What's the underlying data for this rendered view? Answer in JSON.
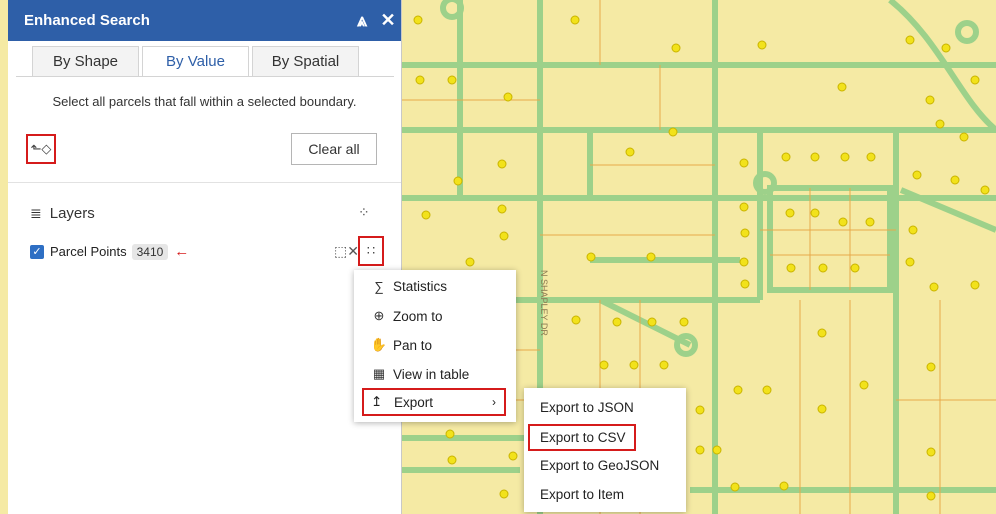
{
  "panel": {
    "title": "Enhanced Search",
    "collapse_icon": "double-chevron-up-icon",
    "close_icon": "close-icon",
    "tabs": [
      {
        "label": "By Shape",
        "active": false
      },
      {
        "label": "By Value",
        "active": true
      },
      {
        "label": "By Spatial",
        "active": false
      }
    ],
    "description": "Select all parcels that fall within a selected boundary.",
    "select_tool_icon": "select-by-polygon-icon",
    "clear_label": "Clear all",
    "layers_label": "Layers",
    "layers_settings_icon": "layer-options-icon",
    "layer": {
      "name": "Parcel Points",
      "count": "3410",
      "checked": true,
      "clear_icon": "clear-selection-icon",
      "actions_icon": "actions-grid-icon"
    }
  },
  "context_menu": {
    "items": [
      {
        "icon": "sigma-icon",
        "label": "Statistics"
      },
      {
        "icon": "zoom-to-icon",
        "label": "Zoom to"
      },
      {
        "icon": "hand-icon",
        "label": "Pan to"
      },
      {
        "icon": "table-icon",
        "label": "View in table"
      }
    ],
    "export": {
      "icon": "export-icon",
      "label": "Export"
    }
  },
  "export_menu": {
    "items": [
      "Export to JSON",
      "Export to CSV",
      "Export to GeoJSON",
      "Export to Item"
    ],
    "highlighted": "Export to CSV"
  },
  "map": {
    "street_label": "N SHAPLEY DR",
    "parcel_fill": "#f5eaa4",
    "road_color": "#9dd18a",
    "point_color": "#f2e21b",
    "highlight_color": "#d51b1b",
    "brand_color": "#2e5fa8"
  }
}
